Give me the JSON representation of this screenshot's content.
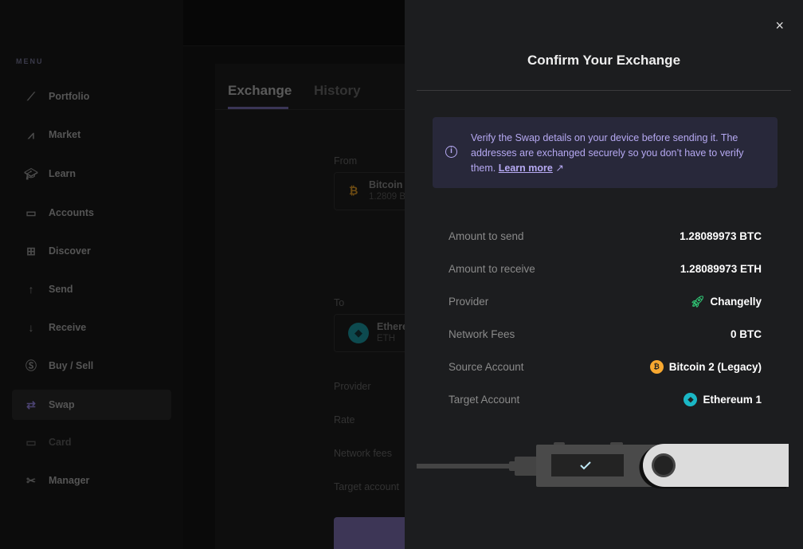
{
  "sidebar": {
    "menu_title": "MENU",
    "items": [
      {
        "label": "Portfolio",
        "icon": "chart-line-icon"
      },
      {
        "label": "Market",
        "icon": "market-icon"
      },
      {
        "label": "Learn",
        "icon": "graduation-cap-icon"
      },
      {
        "label": "Accounts",
        "icon": "wallet-icon"
      },
      {
        "label": "Discover",
        "icon": "grid-icon"
      },
      {
        "label": "Send",
        "icon": "arrow-up-icon"
      },
      {
        "label": "Receive",
        "icon": "arrow-down-icon"
      },
      {
        "label": "Buy / Sell",
        "icon": "dollar-icon"
      },
      {
        "label": "Swap",
        "icon": "swap-icon",
        "active": true
      },
      {
        "label": "Card",
        "icon": "card-icon"
      },
      {
        "label": "Manager",
        "icon": "tools-icon"
      }
    ]
  },
  "exchange": {
    "tabs": [
      "Exchange",
      "History"
    ],
    "from_label": "From",
    "from_name": "Bitcoin",
    "from_amount": "1.2809 B",
    "to_label": "To",
    "to_name": "Ethereum",
    "to_ticker": "ETH",
    "fields": [
      "Provider",
      "Rate",
      "Network fees",
      "Target account"
    ]
  },
  "modal": {
    "title": "Confirm Your Exchange",
    "close": "×",
    "alert_text": "Verify the Swap details on your device before sending it. The addresses are exchanged securely so you don’t have to verify them.",
    "learn_more": "Learn more",
    "rows": [
      {
        "label": "Amount to send",
        "value": "1.28089973 BTC"
      },
      {
        "label": "Amount to receive",
        "value": "1.28089973 ETH"
      },
      {
        "label": "Provider",
        "value": "Changelly"
      },
      {
        "label": "Network Fees",
        "value": "0 BTC"
      },
      {
        "label": "Source Account",
        "value": "Bitcoin 2 (Legacy)"
      },
      {
        "label": "Target Account",
        "value": "Ethereum 1"
      }
    ]
  },
  "colors": {
    "accent": "#b6a9f2",
    "btc": "#f7a830",
    "eth": "#1ab7c5",
    "changelly": "#2fbf71"
  }
}
